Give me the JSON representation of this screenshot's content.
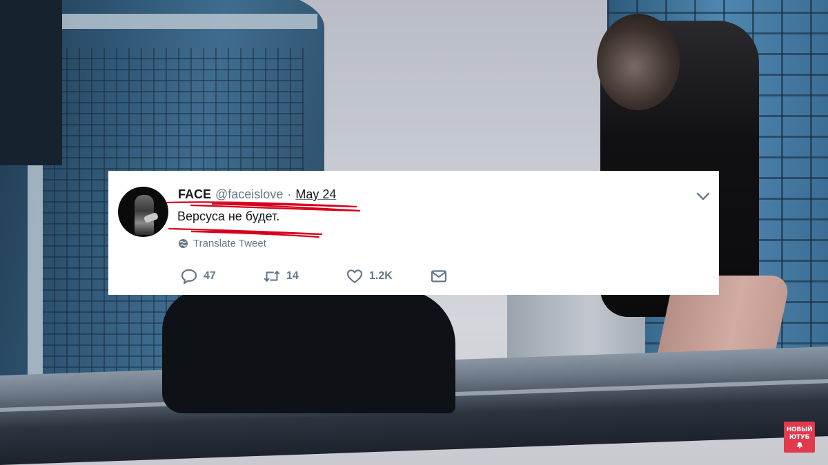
{
  "tweet": {
    "author_name": "FACE",
    "handle": "@faceislove",
    "separator": "·",
    "date": "May 24",
    "text": "Версуса не будет.",
    "translate_label": "Translate Tweet",
    "icons": {
      "menu": "chevron-down-icon",
      "globe": "globe-icon",
      "reply": "reply-icon",
      "retweet": "retweet-icon",
      "like": "heart-icon",
      "dm": "envelope-icon"
    },
    "counts": {
      "replies": "47",
      "retweets": "14",
      "likes": "1.2K"
    }
  },
  "watermark": {
    "line1": "НОВЫЙ",
    "line2": "ЮТУБ",
    "icon": "bell-icon"
  },
  "colors": {
    "text_primary": "#14171a",
    "text_secondary": "#657786",
    "underline_marker": "#d6001c",
    "watermark_bg": "#e23a4d"
  }
}
